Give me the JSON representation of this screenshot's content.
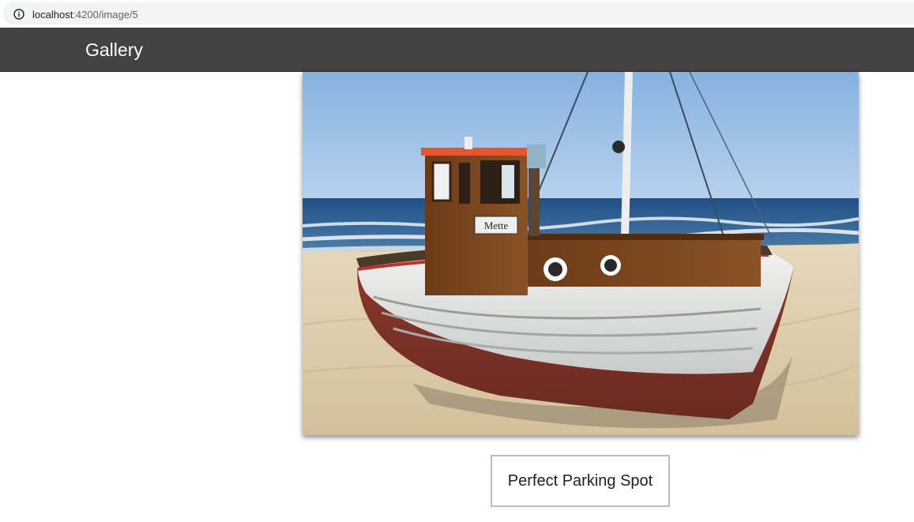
{
  "browser": {
    "url_host": "localhost",
    "url_path": ":4200/image/5",
    "icon": "info-icon"
  },
  "toolbar": {
    "title": "Gallery",
    "background": "#424242"
  },
  "photo": {
    "subject": "boat-on-beach-photo",
    "boat_name": "Mette"
  },
  "caption": {
    "text": "Perfect Parking Spot"
  }
}
